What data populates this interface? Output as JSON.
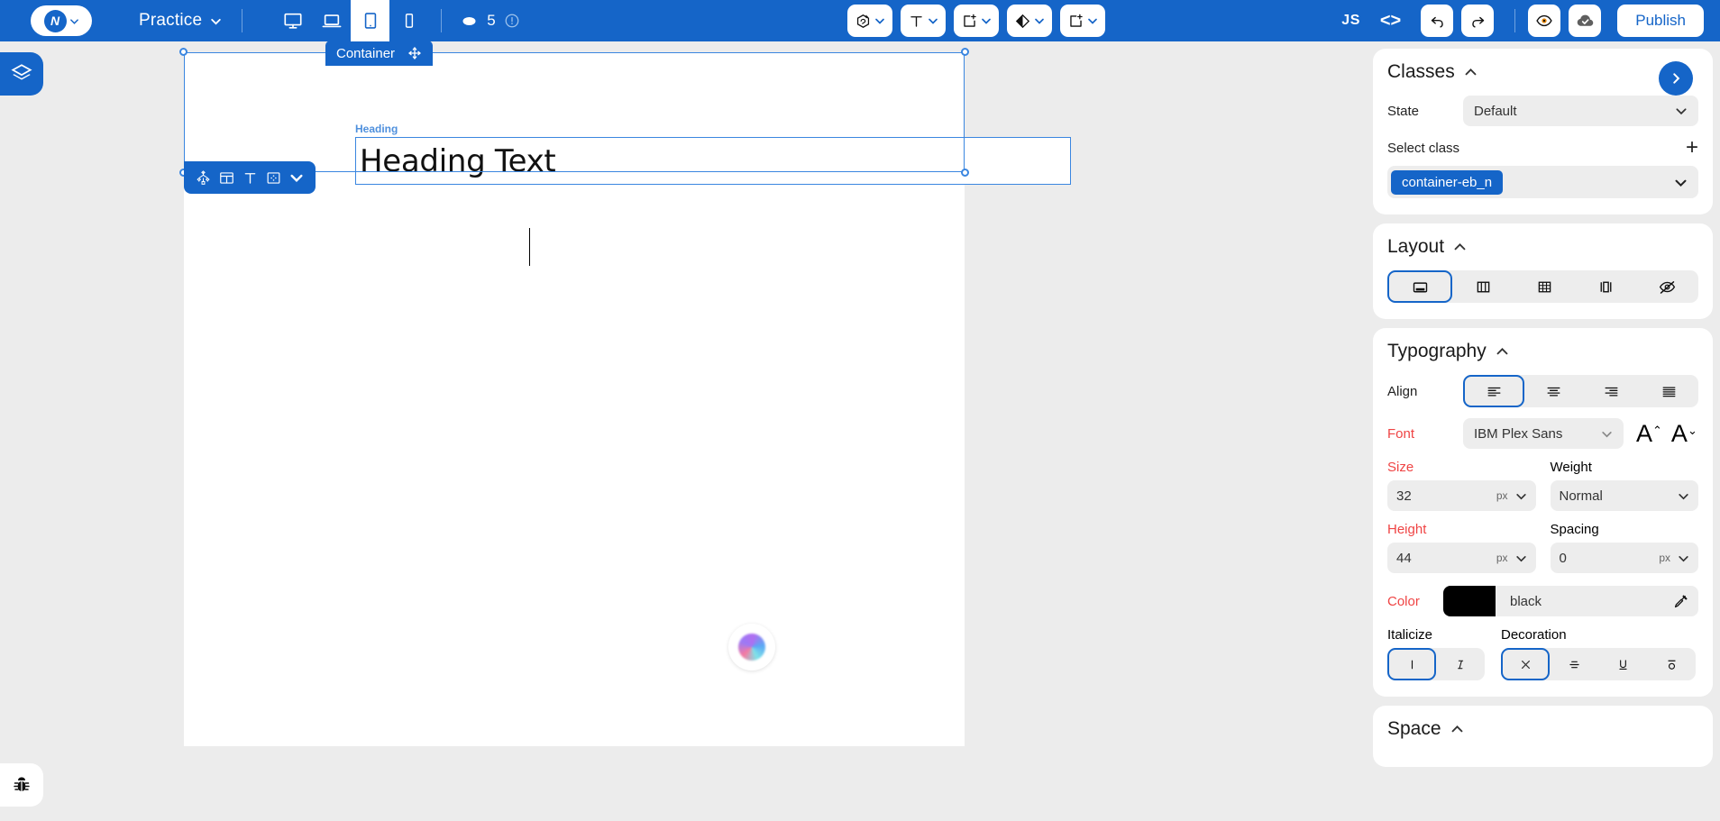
{
  "topbar": {
    "logo_icon": "wavemaker-logo-icon",
    "logo_caret_icon": "chevron-down-icon",
    "project_name": "Practice",
    "project_caret_icon": "chevron-down-icon",
    "devices": [
      {
        "name": "desktop",
        "icon": "monitor-icon",
        "active": false
      },
      {
        "name": "laptop",
        "icon": "laptop-icon",
        "active": false
      },
      {
        "name": "tablet",
        "icon": "tablet-icon",
        "active": true
      },
      {
        "name": "mobile",
        "icon": "phone-icon",
        "active": false
      }
    ],
    "pages_icon": "pages-stack-icon",
    "pages_count": "5",
    "info_icon": "info-circle-icon",
    "tools": [
      {
        "name": "element-add",
        "icon": "element-plus-icon",
        "caret": "chevron-down-icon"
      },
      {
        "name": "text-add",
        "icon": "text-T-icon",
        "caret": "chevron-down-icon"
      },
      {
        "name": "container-add",
        "icon": "container-plus-icon",
        "caret": "chevron-down-icon"
      },
      {
        "name": "media-add",
        "icon": "diamond-half-icon",
        "caret": "chevron-down-icon"
      },
      {
        "name": "component-add",
        "icon": "component-plus-icon",
        "caret": "chevron-down-icon"
      }
    ],
    "js_label": "JS",
    "code_icon": "code-brackets-icon",
    "undo_icon": "undo-arrow-icon",
    "redo_icon": "redo-arrow-icon",
    "preview_icon": "eye-icon",
    "cloud_icon": "cloud-check-icon",
    "publish_label": "Publish",
    "accent": "#1565c8"
  },
  "left_rail": {
    "layers_icon": "layers-stack-icon",
    "bug_icon": "bug-icon"
  },
  "canvas": {
    "selection_tag": "Container",
    "move_icon": "move-cross-icon",
    "heading_label": "Heading",
    "heading_value": "Heading Text",
    "element_toolbar": [
      {
        "name": "tree-select",
        "icon": "node-tree-icon"
      },
      {
        "name": "layout-edit",
        "icon": "layout-columns-icon"
      },
      {
        "name": "text-edit",
        "icon": "text-T-icon"
      },
      {
        "name": "spacing-edit",
        "icon": "dotted-box-icon"
      },
      {
        "name": "more-options",
        "icon": "chevron-down-icon"
      }
    ],
    "ai_orb_icon": "ai-assistant-orb-icon"
  },
  "panel": {
    "classes": {
      "title": "Classes",
      "collapse_icon": "chevron-up-icon",
      "expand_icon": "chevron-right-icon",
      "state_label": "State",
      "state_value": "Default",
      "state_caret": "chevron-down-icon",
      "select_class_label": "Select class",
      "add_icon": "plus-icon",
      "class_chip": "container-eb_n",
      "class_caret": "chevron-down-icon"
    },
    "layout": {
      "title": "Layout",
      "collapse_icon": "chevron-up-icon",
      "modes": [
        {
          "name": "block",
          "icon": "block-box-icon",
          "active": true
        },
        {
          "name": "flex",
          "icon": "flex-columns-icon",
          "active": false
        },
        {
          "name": "grid",
          "icon": "grid-icon",
          "active": false
        },
        {
          "name": "inline-flex",
          "icon": "inline-columns-icon",
          "active": false
        },
        {
          "name": "none",
          "icon": "eye-off-icon",
          "active": false
        }
      ]
    },
    "typography": {
      "title": "Typography",
      "collapse_icon": "chevron-up-icon",
      "align_label": "Align",
      "aligns": [
        {
          "name": "align-left",
          "icon": "align-left-icon",
          "active": true
        },
        {
          "name": "align-center",
          "icon": "align-center-icon",
          "active": false
        },
        {
          "name": "align-right",
          "icon": "align-right-icon",
          "active": false
        },
        {
          "name": "align-justify",
          "icon": "align-justify-icon",
          "active": false
        }
      ],
      "font_label": "Font",
      "font_value": "IBM Plex Sans",
      "font_caret": "chevron-down-icon",
      "font_increase_icon": "font-size-up-icon",
      "font_decrease_icon": "font-size-down-icon",
      "size_label": "Size",
      "size_value": "32",
      "size_unit": "px",
      "weight_label": "Weight",
      "weight_value": "Normal",
      "height_label": "Height",
      "height_value": "44",
      "height_unit": "px",
      "spacing_label": "Spacing",
      "spacing_value": "0",
      "spacing_unit": "px",
      "color_label": "Color",
      "color_value": "black",
      "color_hex": "#000000",
      "pipette_icon": "eyedropper-icon",
      "italicize_label": "Italicize",
      "italics": [
        {
          "name": "italic-off",
          "icon": "upright-I-icon",
          "active": true
        },
        {
          "name": "italic-on",
          "icon": "italic-I-icon",
          "active": false
        }
      ],
      "decoration_label": "Decoration",
      "decorations": [
        {
          "name": "decoration-none",
          "icon": "x-cross-icon",
          "active": true
        },
        {
          "name": "line-through",
          "icon": "strikethrough-icon",
          "active": false
        },
        {
          "name": "underline",
          "icon": "underline-U-icon",
          "active": false
        },
        {
          "name": "overline",
          "icon": "overline-o-icon",
          "active": false
        }
      ]
    },
    "space": {
      "title": "Space",
      "collapse_icon": "chevron-up-icon"
    }
  }
}
